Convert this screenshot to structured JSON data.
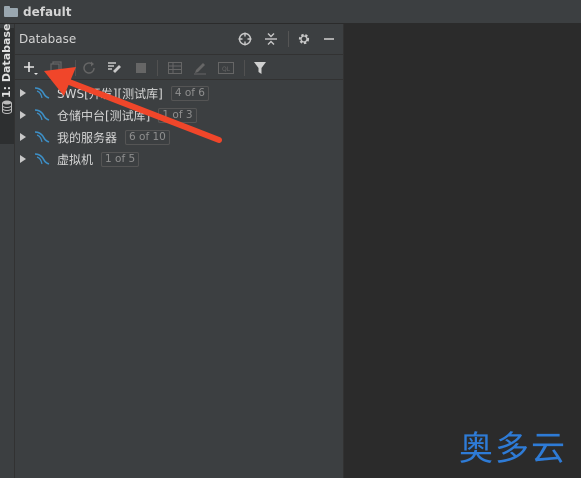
{
  "window": {
    "title": "default"
  },
  "tool_window_tab": {
    "label": "1: Database"
  },
  "panel": {
    "title": "Database",
    "header_icons": [
      "crosshair-icon",
      "collapse-all-icon",
      "gear-icon",
      "minimize-icon"
    ],
    "toolbar_icons": [
      "add-icon",
      "copy-icon",
      "refresh-icon",
      "data-source-properties-icon",
      "stop-icon",
      "table-icon",
      "edit-icon",
      "console-icon",
      "filter-icon"
    ]
  },
  "tree": {
    "items": [
      {
        "label": "SWS[开发][测试库]",
        "badge": "4 of 6"
      },
      {
        "label": "仓储中台[测试库]",
        "badge": "1 of 3"
      },
      {
        "label": "我的服务器",
        "badge": "6 of 10"
      },
      {
        "label": "虚拟机",
        "badge": "1 of 5"
      }
    ]
  },
  "annotation": {
    "arrow_color": "#f0462a"
  },
  "watermark": {
    "text": "奥多云",
    "color": "#2e7bd6"
  }
}
